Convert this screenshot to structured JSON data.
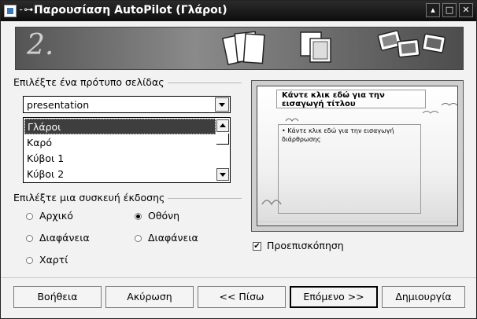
{
  "window": {
    "title": "Παρουσίαση AutoPilot (Γλάροι)",
    "pin_glyph": "-⊶",
    "buttons": {
      "shade": "▴",
      "maximize": "□",
      "close": "✕"
    }
  },
  "banner": {
    "step": "2."
  },
  "page_template": {
    "label": "Επιλέξτε ένα πρότυπο σελίδας",
    "category": "presentation",
    "items": [
      "Γλάροι",
      "Καρό",
      "Κύβοι 1",
      "Κύβοι 2"
    ],
    "selected_index": 0
  },
  "output_medium": {
    "label": "Επιλέξτε μια συσκευή έκδοσης",
    "options": [
      {
        "label": "Αρχικό",
        "checked": false
      },
      {
        "label": "Οθόνη",
        "checked": true
      },
      {
        "label": "Διαφάνεια",
        "checked": false
      },
      {
        "label": "Διαφάνεια",
        "checked": false
      },
      {
        "label": "Χαρτί",
        "checked": false
      }
    ]
  },
  "preview": {
    "slide_title": "Κάντε κλικ εδώ για την εισαγωγή τίτλου",
    "outline_text": "Κάντε κλικ εδώ για την εισαγωγή διάρθρωσης",
    "checkbox_label": "Προεπισκόπηση",
    "checkbox_checked": true,
    "check_glyph": "✔"
  },
  "buttons": {
    "help": "Βοήθεια",
    "cancel": "Ακύρωση",
    "back": "<< Πίσω",
    "next": "Επόμενο >>",
    "create": "Δημιουργία"
  }
}
